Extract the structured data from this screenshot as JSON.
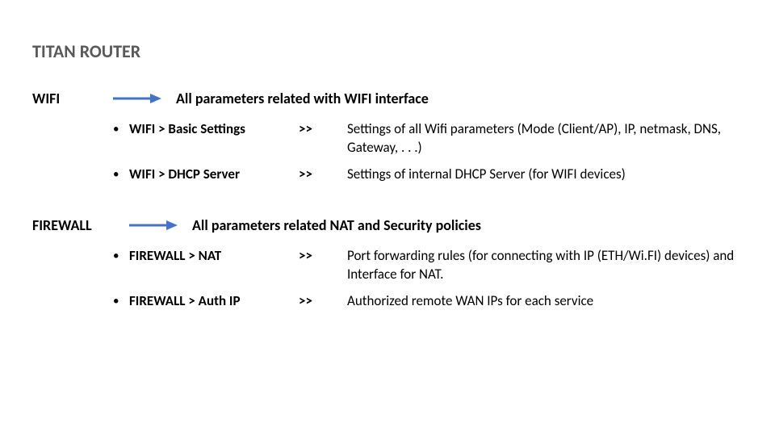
{
  "title": "TITAN ROUTER",
  "sections": [
    {
      "label": "WIFI",
      "desc": "All parameters related with WIFI interface",
      "items": [
        {
          "path": "WIFI > Basic Settings",
          "sep": ">>",
          "expl": "Settings of all Wifi parameters (Mode (Client/AP), IP, netmask, DNS, Gateway, . . .)"
        },
        {
          "path": "WIFI > DHCP Server",
          "sep": ">>",
          "expl": "Settings of internal DHCP Server (for WIFI devices)"
        }
      ]
    },
    {
      "label": "FIREWALL",
      "desc": "All parameters related NAT and Security policies",
      "items": [
        {
          "path": "FIREWALL  > NAT",
          "sep": ">>",
          "expl": "Port forwarding rules (for connecting with IP (ETH/Wi.FI) devices) and Interface for NAT."
        },
        {
          "path": "FIREWALL > Auth IP",
          "sep": ">>",
          "expl": " Authorized remote WAN IPs for each service"
        }
      ]
    }
  ]
}
